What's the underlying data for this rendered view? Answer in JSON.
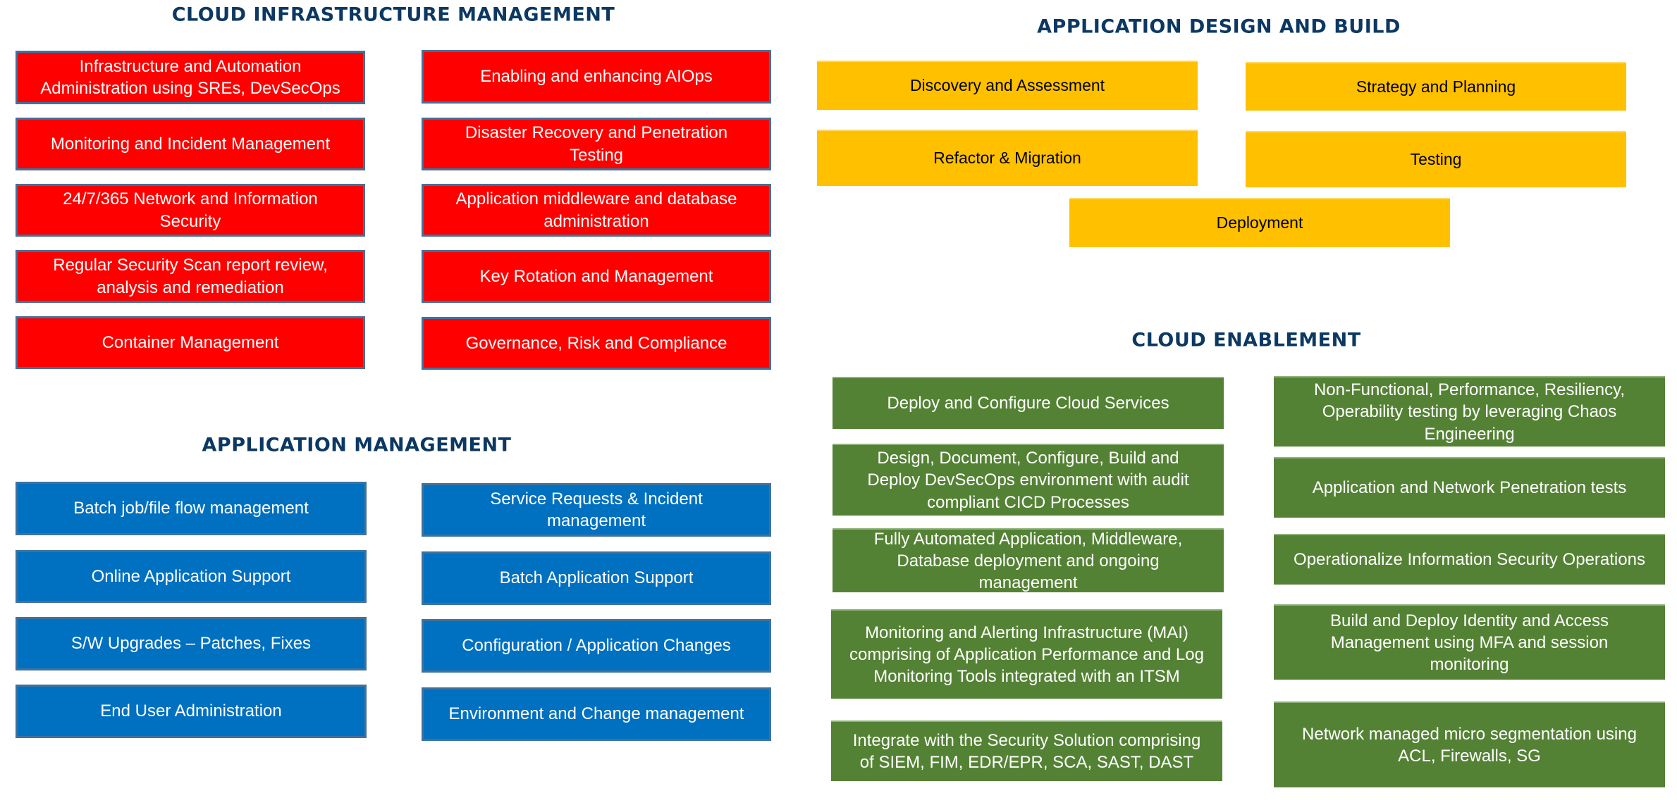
{
  "sections": {
    "cloud_infrastructure": {
      "title": "CLOUD INFRASTRUCTURE MANAGEMENT",
      "color": "#FF0000",
      "left": [
        "Infrastructure and Automation Administration using SREs, DevSecOps",
        "Monitoring and Incident Management",
        "24/7/365 Network and Information Security",
        "Regular Security Scan report review, analysis and remediation",
        "Container Management"
      ],
      "right": [
        "Enabling and enhancing AIOps",
        "Disaster Recovery and Penetration Testing",
        "Application middleware and database administration",
        "Key Rotation and Management",
        "Governance, Risk and Compliance"
      ]
    },
    "application_management": {
      "title": "APPLICATION MANAGEMENT",
      "color": "#0070C0",
      "left": [
        "Batch job/file flow management",
        "Online Application Support",
        "S/W Upgrades – Patches, Fixes",
        "End User Administration"
      ],
      "right": [
        "Service Requests & Incident management",
        "Batch Application Support",
        "Configuration / Application Changes",
        "Environment and Change management"
      ]
    },
    "application_design": {
      "title": "APPLICATION DESIGN AND BUILD",
      "color": "#FFC000",
      "items": [
        "Discovery and Assessment",
        "Strategy and Planning",
        "Refactor & Migration",
        "Testing",
        "Deployment"
      ]
    },
    "cloud_enablement": {
      "title": "CLOUD ENABLEMENT",
      "color": "#548235",
      "left": [
        "Deploy and Configure Cloud Services",
        "Design, Document, Configure, Build and Deploy DevSecOps environment with audit compliant CICD Processes",
        "Fully Automated Application, Middleware, Database deployment and ongoing management",
        "Monitoring and Alerting Infrastructure (MAI) comprising of  Application Performance and Log Monitoring Tools integrated with an ITSM",
        "Integrate with the Security Solution comprising of SIEM, FIM, EDR/EPR, SCA, SAST, DAST"
      ],
      "right": [
        "Non-Functional, Performance, Resiliency, Operability testing by leveraging Chaos Engineering",
        "Application and Network Penetration tests",
        "Operationalize Information Security Operations",
        "Build and Deploy Identity and Access Management using MFA and session monitoring",
        "Network managed micro segmentation using ACL, Firewalls, SG"
      ]
    }
  }
}
